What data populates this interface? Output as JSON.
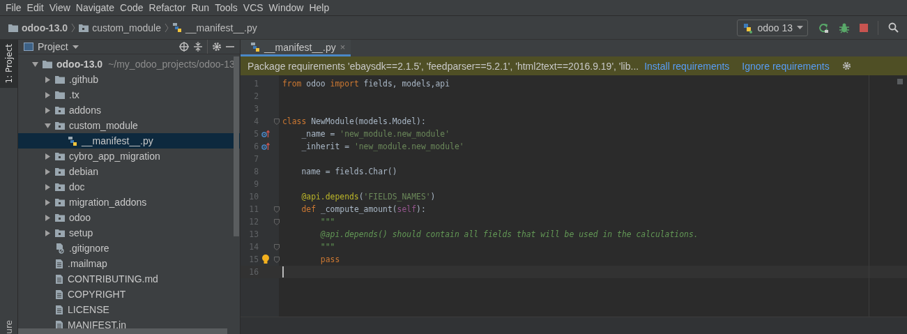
{
  "menu": [
    {
      "label": "File"
    },
    {
      "label": "Edit"
    },
    {
      "label": "View"
    },
    {
      "label": "Navigate"
    },
    {
      "label": "Code"
    },
    {
      "label": "Refactor"
    },
    {
      "label": "Run"
    },
    {
      "label": "Tools"
    },
    {
      "label": "VCS"
    },
    {
      "label": "Window"
    },
    {
      "label": "Help"
    }
  ],
  "breadcrumbs": [
    {
      "label": "odoo-13.0",
      "kind": "folder"
    },
    {
      "label": "custom_module",
      "kind": "module"
    },
    {
      "label": "__manifest__.py",
      "kind": "python"
    }
  ],
  "run_config": {
    "label": "odoo 13"
  },
  "side_tabs": [
    {
      "label": "1: Project",
      "selected": true
    },
    {
      "label": "ure",
      "selected": false
    }
  ],
  "project_panel": {
    "title": "Project",
    "tree": [
      {
        "label": "odoo-13.0",
        "path": "~/my_odoo_projects/odoo-13",
        "kind": "folder",
        "expanded": true,
        "selected": false,
        "children": [
          {
            "label": ".github",
            "kind": "folder",
            "expanded": false,
            "selected": false
          },
          {
            "label": ".tx",
            "kind": "folder",
            "expanded": false,
            "selected": false
          },
          {
            "label": "addons",
            "kind": "module",
            "expanded": false,
            "selected": false
          },
          {
            "label": "custom_module",
            "kind": "module",
            "expanded": true,
            "selected": false,
            "children": [
              {
                "label": "__manifest__.py",
                "kind": "python",
                "selected": true
              }
            ]
          },
          {
            "label": "cybro_app_migration",
            "kind": "module",
            "expanded": false,
            "selected": false
          },
          {
            "label": "debian",
            "kind": "module",
            "expanded": false,
            "selected": false
          },
          {
            "label": "doc",
            "kind": "module",
            "expanded": false,
            "selected": false
          },
          {
            "label": "migration_addons",
            "kind": "module",
            "expanded": false,
            "selected": false
          },
          {
            "label": "odoo",
            "kind": "module",
            "expanded": false,
            "selected": false
          },
          {
            "label": "setup",
            "kind": "module",
            "expanded": false,
            "selected": false
          },
          {
            "label": ".gitignore",
            "kind": "ignore",
            "selected": false
          },
          {
            "label": ".mailmap",
            "kind": "text",
            "selected": false
          },
          {
            "label": "CONTRIBUTING.md",
            "kind": "text",
            "selected": false
          },
          {
            "label": "COPYRIGHT",
            "kind": "text",
            "selected": false
          },
          {
            "label": "LICENSE",
            "kind": "text",
            "selected": false
          },
          {
            "label": "MANIFEST.in",
            "kind": "text",
            "selected": false
          }
        ]
      }
    ]
  },
  "editor_tabs": [
    {
      "label": "__manifest__.py",
      "close": "×",
      "selected": true
    }
  ],
  "notification": {
    "message": "Package requirements 'ebaysdk==2.1.5', 'feedparser==5.2.1', 'html2text==2016.9.19', 'lib...",
    "actions": [
      {
        "label": "Install requirements"
      },
      {
        "label": "Ignore requirements"
      }
    ]
  },
  "code": [
    {
      "number": "1",
      "tokens": [
        {
          "kind": "kw",
          "text": "from "
        },
        {
          "kind": "plain",
          "text": "odoo "
        },
        {
          "kind": "kw",
          "text": "import "
        },
        {
          "kind": "plain",
          "text": "fields, models,api"
        }
      ]
    },
    {
      "number": "2"
    },
    {
      "number": "3"
    },
    {
      "number": "4",
      "fold": true,
      "tokens": [
        {
          "kind": "kw",
          "text": "class "
        },
        {
          "kind": "plain",
          "text": "NewModule(models.Model):"
        }
      ]
    },
    {
      "number": "5",
      "kind": "override",
      "tokens": [
        {
          "kind": "plain",
          "text": "    _name = "
        },
        {
          "kind": "str",
          "text": "'new_module.new_module'"
        }
      ]
    },
    {
      "number": "6",
      "kind": "override",
      "tokens": [
        {
          "kind": "plain",
          "text": "    _inherit = "
        },
        {
          "kind": "str",
          "text": "'new_module.new_module'"
        }
      ]
    },
    {
      "number": "7"
    },
    {
      "number": "8",
      "tokens": [
        {
          "kind": "plain",
          "text": "    name = fields.Char()"
        }
      ]
    },
    {
      "number": "9"
    },
    {
      "number": "10",
      "tokens": [
        {
          "kind": "deco",
          "text": "    @api.depends"
        },
        {
          "kind": "plain",
          "text": "("
        },
        {
          "kind": "str",
          "text": "'FIELDS_NAMES'"
        },
        {
          "kind": "plain",
          "text": ")"
        }
      ]
    },
    {
      "number": "11",
      "fold": true,
      "tokens": [
        {
          "kind": "kw",
          "text": "    def "
        },
        {
          "kind": "fn",
          "text": "_compute_amount"
        },
        {
          "kind": "plain",
          "text": "("
        },
        {
          "kind": "self",
          "text": "self"
        },
        {
          "kind": "plain",
          "text": "):"
        }
      ]
    },
    {
      "number": "12",
      "fold": true,
      "tokens": [
        {
          "kind": "doc",
          "text": "        \"\"\""
        }
      ]
    },
    {
      "number": "13",
      "tokens": [
        {
          "kind": "doc",
          "text": "        @api.depends() should contain all fields that will be used in the calculations."
        }
      ]
    },
    {
      "number": "14",
      "fold": true,
      "tokens": [
        {
          "kind": "doc",
          "text": "        \"\"\""
        }
      ]
    },
    {
      "number": "15",
      "fold": true,
      "kind": "bulb",
      "tokens": [
        {
          "kind": "kw",
          "text": "        pass"
        }
      ]
    },
    {
      "number": "16",
      "current": true
    }
  ]
}
